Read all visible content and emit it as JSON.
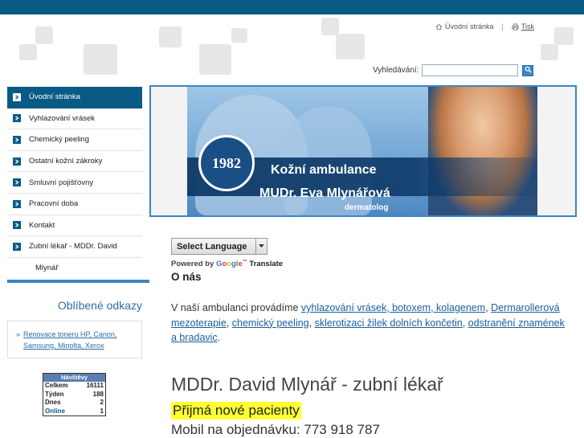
{
  "top_links": {
    "home": "Úvodní stránka",
    "separator": "|",
    "print": "Tisk"
  },
  "search": {
    "label": "Vyhledávání:",
    "value": "",
    "placeholder": ""
  },
  "nav": [
    "Úvodní stránka",
    "Vyhlazování vrásek",
    "Chemický peeling",
    "Ostatní kožní zákroky",
    "Smluvní pojišťovny",
    "Pracovní doba",
    "Kontakt",
    "Zubní lékař - MDDr. David"
  ],
  "nav_continuation": "Mlynář",
  "favorites": {
    "title": "Oblíbené odkazy",
    "arrow": "»",
    "link": "Renovace toneru HP, Canon, Samsung, Minolta, Xerox"
  },
  "counter": {
    "title": "Návštěvy",
    "rows": [
      {
        "label": "Celkem",
        "value": "16111"
      },
      {
        "label": "Týden",
        "value": "188"
      },
      {
        "label": "Dnes",
        "value": "2"
      },
      {
        "label": "Online",
        "value": "1"
      }
    ]
  },
  "banner": {
    "year": "1982",
    "title": "Kožní ambulance",
    "name": "MUDr. Eva Mlynářová",
    "subtitle": "dermatolog"
  },
  "translate": {
    "button": "Select Language",
    "powered_by": "Powered by",
    "google": [
      "G",
      "o",
      "o",
      "g",
      "l",
      "e"
    ],
    "tm": "™",
    "translate_word": "Translate"
  },
  "content": {
    "heading": "O nás",
    "intro_text_1": "V naší ambulanci provádíme ",
    "link_1": "vyhlazování vrásek, botoxem, kolagenem",
    "sep_1": ", ",
    "link_2": "Dermarollerová mezoterapie",
    "sep_2": ", ",
    "link_3": "chemický peeling",
    "sep_3": ", ",
    "link_4": "sklerotizaci žilek dolních končetin,",
    "sep_4": " ",
    "link_5": "odstranění znamének a bradavic",
    "intro_end": ".",
    "dentist_heading": "MDDr. David Mlynář - zubní lékař",
    "accepting": "Přijmá nové pacienty",
    "mobile": "Mobil na objednávku: 773 918 787"
  },
  "colors": {
    "brand": "#0a5a86",
    "accent": "#3a86c4",
    "link": "#1a5f9a",
    "highlight": "#ffff33"
  }
}
